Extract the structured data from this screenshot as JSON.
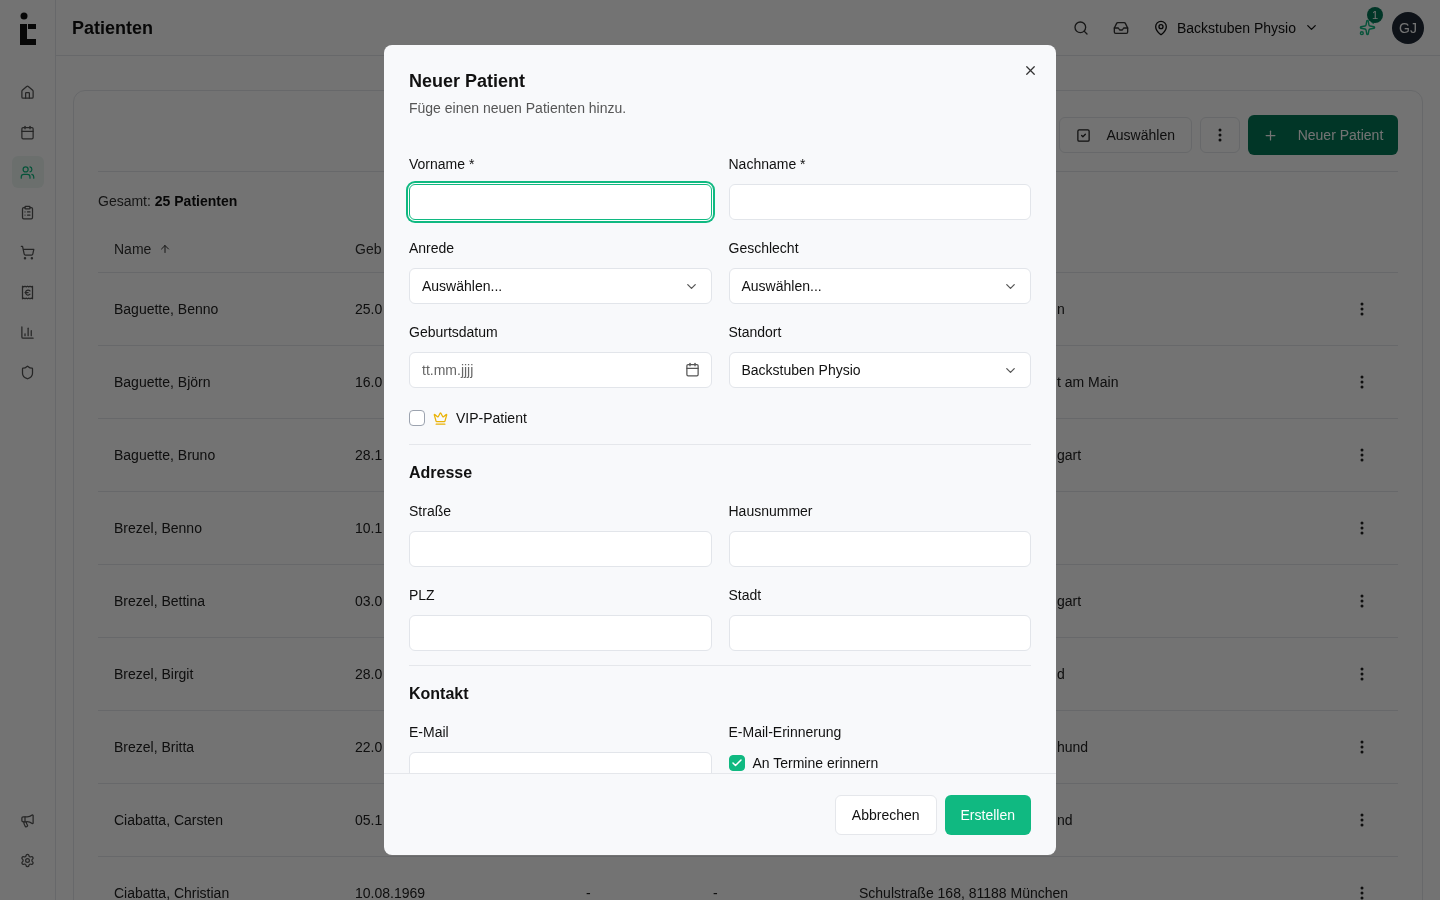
{
  "header": {
    "title": "Patienten",
    "location": "Backstuben Physio",
    "notification_count": "1",
    "avatar_initials": "GJ"
  },
  "sidebar": {
    "items": [
      {
        "kind": "home",
        "selected": false
      },
      {
        "kind": "calendar",
        "selected": false
      },
      {
        "kind": "users",
        "selected": true
      },
      {
        "kind": "clipboard",
        "selected": false
      },
      {
        "kind": "cart",
        "selected": false
      },
      {
        "kind": "invoice",
        "selected": false
      },
      {
        "kind": "chart",
        "selected": false
      },
      {
        "kind": "shield",
        "selected": false
      }
    ],
    "bottom_items": [
      {
        "kind": "megaphone"
      },
      {
        "kind": "settings"
      }
    ]
  },
  "toolbar": {
    "select_button": "Auswählen",
    "new_button": "Neuer Patient"
  },
  "summary": {
    "label": "Gesamt:",
    "value": "25 Patienten"
  },
  "table": {
    "columns": [
      "Name",
      "Geb"
    ],
    "rows": [
      {
        "kind": "behind_dialog",
        "name": "Baguette, Benno",
        "birthdate": "25.0",
        "address": "n"
      },
      {
        "kind": "behind_dialog",
        "name": "Baguette, Björn",
        "birthdate": "16.0",
        "address": "t am Main"
      },
      {
        "kind": "behind_dialog",
        "name": "Baguette, Bruno",
        "birthdate": "28.1",
        "address": "gart"
      },
      {
        "kind": "behind_dialog",
        "name": "Brezel, Benno",
        "birthdate": "10.1"
      },
      {
        "kind": "behind_dialog",
        "name": "Brezel, Bettina",
        "birthdate": "03.0",
        "address": "gart"
      },
      {
        "kind": "behind_dialog",
        "name": "Brezel, Birgit",
        "birthdate": "28.0",
        "address": "d"
      },
      {
        "kind": "behind_dialog",
        "name": "Brezel, Britta",
        "birthdate": "22.0",
        "address": "hund"
      },
      {
        "kind": "behind_dialog",
        "name": "Ciabatta, Carsten",
        "birthdate": "05.1",
        "address": "nd"
      },
      {
        "kind": "full",
        "name": "Ciabatta, Christian",
        "birthdate": "10.08.1969",
        "column_3": "-",
        "column_4": "-",
        "address": "Schulstraße 168, 81188 München"
      }
    ]
  },
  "dialog": {
    "title": "Neuer Patient",
    "subtitle": "Füge einen neuen Patienten hinzu.",
    "sections": [
      {
        "fields": [
          {
            "kind": "text",
            "label": "Vorname *",
            "focused": true
          },
          {
            "kind": "text",
            "label": "Nachname *",
            "focused": false
          },
          {
            "kind": "select",
            "label": "Anrede",
            "value": "Auswählen..."
          },
          {
            "kind": "select",
            "label": "Geschlecht",
            "value": "Auswählen..."
          },
          {
            "kind": "date",
            "label": "Geburtsdatum",
            "placeholder": "tt.mm.jjjj"
          },
          {
            "kind": "select",
            "label": "Standort",
            "value": "Backstuben Physio"
          },
          {
            "kind": "vip_checkbox",
            "option": "VIP-Patient",
            "checked": false
          }
        ]
      },
      {
        "heading": "Adresse",
        "fields": [
          {
            "kind": "text",
            "label": "Straße",
            "focused": false
          },
          {
            "kind": "text",
            "label": "Hausnummer",
            "focused": false
          },
          {
            "kind": "text",
            "label": "PLZ",
            "focused": false
          },
          {
            "kind": "text",
            "label": "Stadt",
            "focused": false
          }
        ]
      },
      {
        "heading": "Kontakt",
        "fields": [
          {
            "kind": "text",
            "label": "E-Mail",
            "focused": false
          },
          {
            "kind": "checkbox",
            "label": "E-Mail-Erinnerung",
            "option": "An Termine erinnern",
            "checked": true
          }
        ]
      }
    ],
    "buttons": [
      {
        "kind": "secondary",
        "label": "Abbrechen"
      },
      {
        "kind": "primary",
        "label": "Erstellen"
      }
    ]
  }
}
